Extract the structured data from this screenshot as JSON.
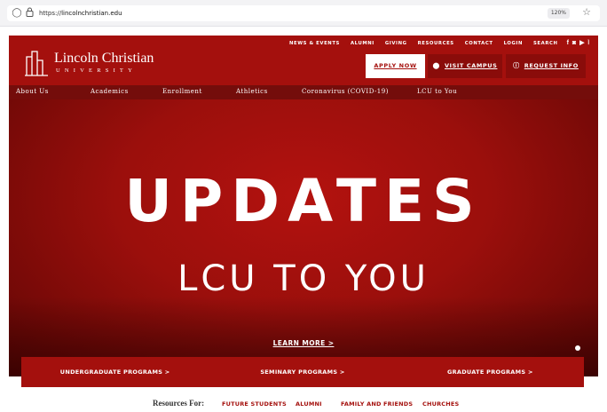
{
  "browser": {
    "url_prefix": "https://",
    "url_domain": "lincolnchristian.edu",
    "zoom": "120%"
  },
  "header": {
    "utility_nav": [
      "NEWS & EVENTS",
      "ALUMNI",
      "GIVING",
      "RESOURCES",
      "CONTACT",
      "LOGIN",
      "SEARCH"
    ],
    "social_icons": [
      "facebook-icon",
      "instagram-icon",
      "youtube-icon",
      "rss-icon"
    ],
    "logo_name": "Lincoln Christian",
    "logo_sub": "UNIVERSITY",
    "apply": "APPLY NOW",
    "visit": "VISIT CAMPUS",
    "info": "REQUEST INFO"
  },
  "main_nav": [
    "About Us",
    "Academics",
    "Enrollment",
    "Athletics",
    "Coronavirus (COVID-19)",
    "LCU to You"
  ],
  "hero": {
    "title": "UPDATES",
    "subtitle": "LCU TO YOU",
    "learn_more": "LEARN MORE >"
  },
  "programs": [
    "UNDERGRADUATE PROGRAMS >",
    "SEMINARY PROGRAMS >",
    "GRADUATE PROGRAMS >"
  ],
  "resources": {
    "label": "Resources For:",
    "links": [
      "FUTURE STUDENTS",
      "ALUMNI",
      "FAMILY AND FRIENDS",
      "CHURCHES"
    ]
  },
  "colors": {
    "brand_red": "#a4100d",
    "dark_red": "#740d0b"
  }
}
